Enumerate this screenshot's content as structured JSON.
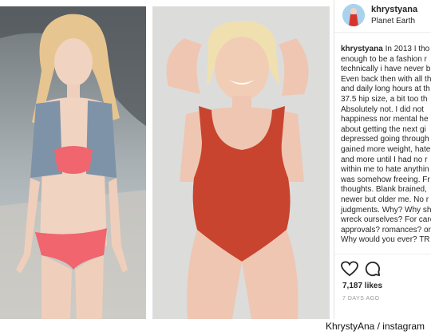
{
  "post": {
    "username": "khrystyana",
    "location": "Planet Earth",
    "caption_lines": [
      {
        "user": "khrystyana",
        "text": " In 2013 I tho"
      },
      {
        "text": "enough to be a fashion r"
      },
      {
        "text": "technically i have never b"
      },
      {
        "text": "Even back then with all th"
      },
      {
        "text": "and daily long hours at th"
      },
      {
        "text": "37.5 hip size, a bit too th"
      },
      {
        "text": "Absolutely not. I did not"
      },
      {
        "text": "happiness nor mental he"
      },
      {
        "text": "about getting the next gi"
      },
      {
        "text": "depressed going through"
      },
      {
        "text": "gained more weight, hate"
      },
      {
        "text": "and more until I had no r"
      },
      {
        "text": "within me to hate anythin"
      },
      {
        "text": "was somehow freeing. Fr"
      },
      {
        "text": "thoughts. Blank brained,"
      },
      {
        "text": "newer but older me. No r"
      },
      {
        "text": "judgments. Why? Why sh"
      },
      {
        "text": "wreck ourselves? For care"
      },
      {
        "text": "approvals? romances? or"
      },
      {
        "text": "Why would you ever? TR"
      }
    ],
    "likes": "7,187 likes",
    "time": "7 DAYS AGO"
  },
  "credit": "KhrystyAna  / instagram",
  "icons": [
    "heart-icon",
    "comment-icon"
  ],
  "colors": {
    "swimsuit_left": "#f0656e",
    "swimsuit_right": "#c8442f",
    "text": "#262626"
  }
}
